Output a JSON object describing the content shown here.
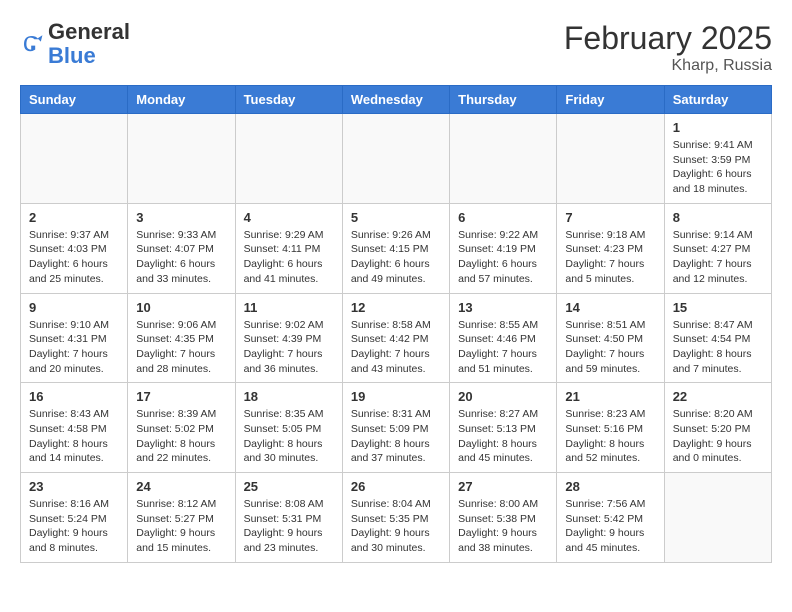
{
  "header": {
    "logo_general": "General",
    "logo_blue": "Blue",
    "month_year": "February 2025",
    "location": "Kharp, Russia"
  },
  "weekdays": [
    "Sunday",
    "Monday",
    "Tuesday",
    "Wednesday",
    "Thursday",
    "Friday",
    "Saturday"
  ],
  "weeks": [
    [
      {
        "day": "",
        "info": ""
      },
      {
        "day": "",
        "info": ""
      },
      {
        "day": "",
        "info": ""
      },
      {
        "day": "",
        "info": ""
      },
      {
        "day": "",
        "info": ""
      },
      {
        "day": "",
        "info": ""
      },
      {
        "day": "1",
        "info": "Sunrise: 9:41 AM\nSunset: 3:59 PM\nDaylight: 6 hours and 18 minutes."
      }
    ],
    [
      {
        "day": "2",
        "info": "Sunrise: 9:37 AM\nSunset: 4:03 PM\nDaylight: 6 hours and 25 minutes."
      },
      {
        "day": "3",
        "info": "Sunrise: 9:33 AM\nSunset: 4:07 PM\nDaylight: 6 hours and 33 minutes."
      },
      {
        "day": "4",
        "info": "Sunrise: 9:29 AM\nSunset: 4:11 PM\nDaylight: 6 hours and 41 minutes."
      },
      {
        "day": "5",
        "info": "Sunrise: 9:26 AM\nSunset: 4:15 PM\nDaylight: 6 hours and 49 minutes."
      },
      {
        "day": "6",
        "info": "Sunrise: 9:22 AM\nSunset: 4:19 PM\nDaylight: 6 hours and 57 minutes."
      },
      {
        "day": "7",
        "info": "Sunrise: 9:18 AM\nSunset: 4:23 PM\nDaylight: 7 hours and 5 minutes."
      },
      {
        "day": "8",
        "info": "Sunrise: 9:14 AM\nSunset: 4:27 PM\nDaylight: 7 hours and 12 minutes."
      }
    ],
    [
      {
        "day": "9",
        "info": "Sunrise: 9:10 AM\nSunset: 4:31 PM\nDaylight: 7 hours and 20 minutes."
      },
      {
        "day": "10",
        "info": "Sunrise: 9:06 AM\nSunset: 4:35 PM\nDaylight: 7 hours and 28 minutes."
      },
      {
        "day": "11",
        "info": "Sunrise: 9:02 AM\nSunset: 4:39 PM\nDaylight: 7 hours and 36 minutes."
      },
      {
        "day": "12",
        "info": "Sunrise: 8:58 AM\nSunset: 4:42 PM\nDaylight: 7 hours and 43 minutes."
      },
      {
        "day": "13",
        "info": "Sunrise: 8:55 AM\nSunset: 4:46 PM\nDaylight: 7 hours and 51 minutes."
      },
      {
        "day": "14",
        "info": "Sunrise: 8:51 AM\nSunset: 4:50 PM\nDaylight: 7 hours and 59 minutes."
      },
      {
        "day": "15",
        "info": "Sunrise: 8:47 AM\nSunset: 4:54 PM\nDaylight: 8 hours and 7 minutes."
      }
    ],
    [
      {
        "day": "16",
        "info": "Sunrise: 8:43 AM\nSunset: 4:58 PM\nDaylight: 8 hours and 14 minutes."
      },
      {
        "day": "17",
        "info": "Sunrise: 8:39 AM\nSunset: 5:02 PM\nDaylight: 8 hours and 22 minutes."
      },
      {
        "day": "18",
        "info": "Sunrise: 8:35 AM\nSunset: 5:05 PM\nDaylight: 8 hours and 30 minutes."
      },
      {
        "day": "19",
        "info": "Sunrise: 8:31 AM\nSunset: 5:09 PM\nDaylight: 8 hours and 37 minutes."
      },
      {
        "day": "20",
        "info": "Sunrise: 8:27 AM\nSunset: 5:13 PM\nDaylight: 8 hours and 45 minutes."
      },
      {
        "day": "21",
        "info": "Sunrise: 8:23 AM\nSunset: 5:16 PM\nDaylight: 8 hours and 52 minutes."
      },
      {
        "day": "22",
        "info": "Sunrise: 8:20 AM\nSunset: 5:20 PM\nDaylight: 9 hours and 0 minutes."
      }
    ],
    [
      {
        "day": "23",
        "info": "Sunrise: 8:16 AM\nSunset: 5:24 PM\nDaylight: 9 hours and 8 minutes."
      },
      {
        "day": "24",
        "info": "Sunrise: 8:12 AM\nSunset: 5:27 PM\nDaylight: 9 hours and 15 minutes."
      },
      {
        "day": "25",
        "info": "Sunrise: 8:08 AM\nSunset: 5:31 PM\nDaylight: 9 hours and 23 minutes."
      },
      {
        "day": "26",
        "info": "Sunrise: 8:04 AM\nSunset: 5:35 PM\nDaylight: 9 hours and 30 minutes."
      },
      {
        "day": "27",
        "info": "Sunrise: 8:00 AM\nSunset: 5:38 PM\nDaylight: 9 hours and 38 minutes."
      },
      {
        "day": "28",
        "info": "Sunrise: 7:56 AM\nSunset: 5:42 PM\nDaylight: 9 hours and 45 minutes."
      },
      {
        "day": "",
        "info": ""
      }
    ]
  ]
}
